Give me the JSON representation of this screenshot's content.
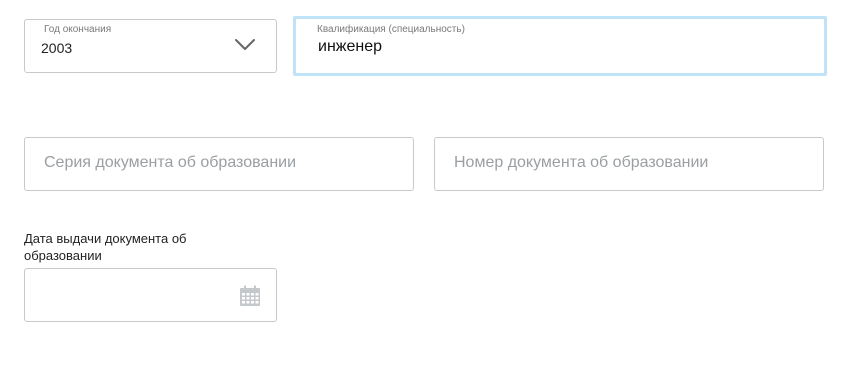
{
  "education": {
    "year_field": {
      "label": "Год окончания",
      "value": "2003",
      "icon": "chevron-down-icon"
    },
    "qualification_field": {
      "label": "Квалификация (специальность)",
      "value": "инженер"
    },
    "document_series_field": {
      "placeholder": "Серия документа об образовании"
    },
    "document_number_field": {
      "placeholder": "Номер документа об образовании"
    },
    "issue_date_field": {
      "label": "Дата выдачи документа об образовании",
      "value": "",
      "icon": "calendar-icon"
    }
  },
  "colors": {
    "focus_border": "#bfe3f7",
    "border": "#c9c9c9",
    "placeholder": "#9a9fa3",
    "icon": "#b8bcbf"
  }
}
